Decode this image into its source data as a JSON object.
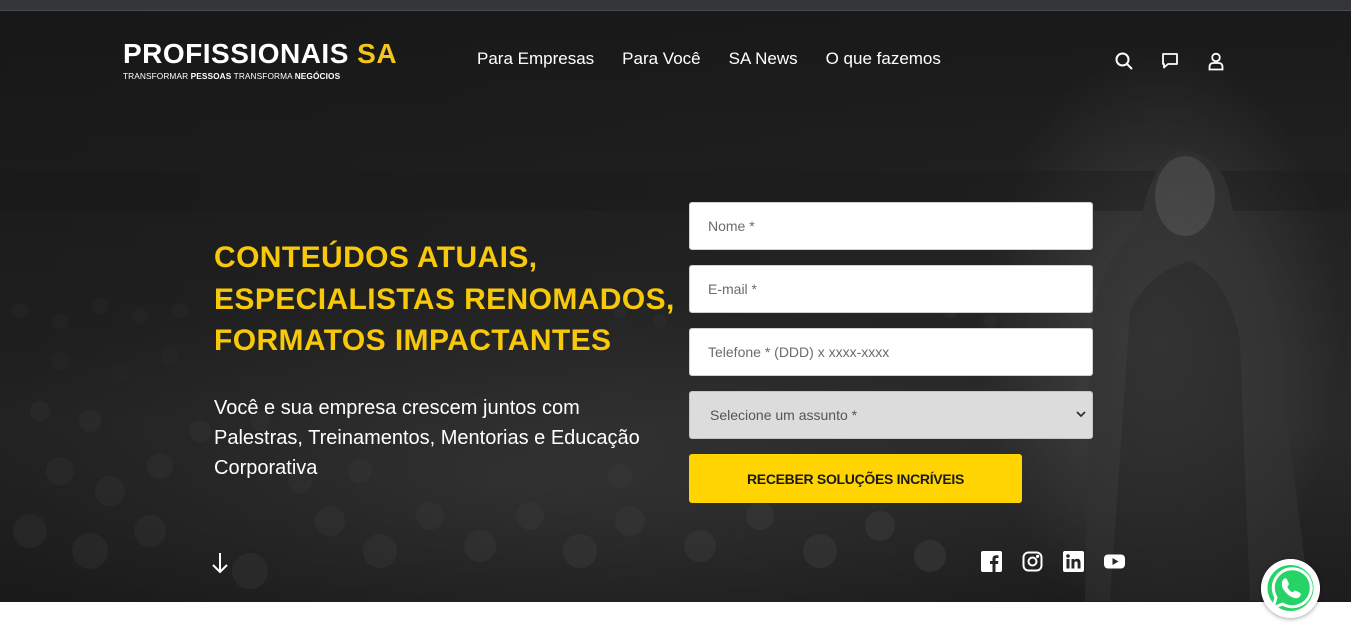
{
  "brand": {
    "name_main": "PROFISSIONAIS",
    "name_accent": "SA",
    "tagline_parts": [
      "TRANSFORMAR ",
      "PESSOAS",
      " TRANSFORMA ",
      "NEGÓCIOS"
    ],
    "accent_color": "#f5c518"
  },
  "nav": {
    "items": [
      {
        "label": "Para Empresas"
      },
      {
        "label": "Para Você"
      },
      {
        "label": "SA News"
      },
      {
        "label": "O que fazemos"
      }
    ],
    "icons": [
      "search-icon",
      "chat-icon",
      "user-icon"
    ]
  },
  "hero": {
    "headline": [
      "CONTEÚDOS ATUAIS,",
      "ESPECIALISTAS RENOMADOS,",
      "FORMATOS IMPACTANTES"
    ],
    "headline_color": "#f7c90a",
    "subtext": [
      "Você e sua empresa crescem juntos com",
      "Palestras, Treinamentos, Mentorias e Educação",
      "Corporativa"
    ]
  },
  "form": {
    "name_placeholder": "Nome *",
    "email_placeholder": "E-mail *",
    "phone_placeholder": "Telefone * (DDD) x xxxx-xxxx",
    "subject_selected": "Selecione um assunto *",
    "submit_label": "RECEBER SOLUÇÕES INCRÍVEIS",
    "submit_color": "#ffd400"
  },
  "socials": [
    "facebook-icon",
    "instagram-icon",
    "linkedin-icon",
    "youtube-icon"
  ],
  "floating": {
    "whatsapp": "whatsapp-icon",
    "whatsapp_color": "#25d366"
  }
}
